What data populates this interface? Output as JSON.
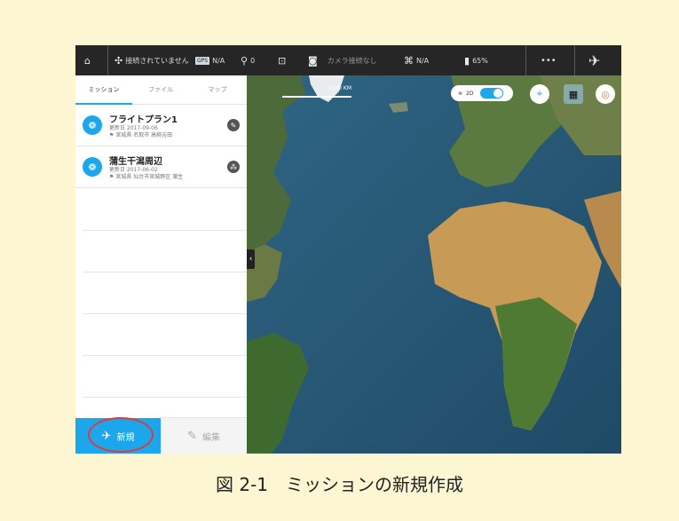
{
  "topbar": {
    "home_icon": "home-icon",
    "drone_status": "接続されていません",
    "gps_chip": "GPS",
    "gps_value": "N/A",
    "signal_value": "0",
    "camera_status": "カメラ接続なし",
    "map_value": "N/A",
    "battery_value": "65%",
    "more_label": "•••"
  },
  "sidebar": {
    "tabs": [
      {
        "label": "ミッション",
        "active": true
      },
      {
        "label": "ファイル",
        "active": false
      },
      {
        "label": "マップ",
        "active": false
      }
    ],
    "missions": [
      {
        "title": "フライトプラン1",
        "date": "更新日 2017-09-06",
        "location": "宮城県 名取市 高柳吉田"
      },
      {
        "title": "蒲生干潟周辺",
        "date": "更新日 2017-06-02",
        "location": "宮城県 仙台市宮城野区 蒲生"
      }
    ],
    "new_label": "新規",
    "edit_label": "編集"
  },
  "map": {
    "scale_label": "1000 KM",
    "mode_label": "2D",
    "collapse_icon": "chevron-left-icon"
  },
  "caption": "図 2-1　ミッションの新規作成",
  "colors": {
    "accent": "#1ca7ec",
    "highlight": "#e23a3a",
    "page_bg": "#fdf6d3"
  }
}
